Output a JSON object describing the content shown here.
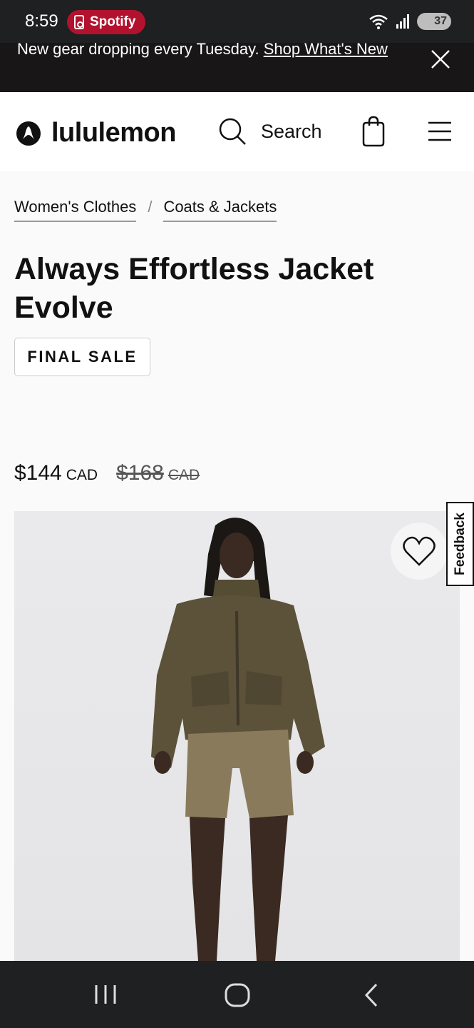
{
  "status_bar": {
    "time": "8:59",
    "app_pill": "Spotify",
    "battery": "37"
  },
  "promo": {
    "text": "New gear dropping every Tuesday.",
    "link": "Shop What's New"
  },
  "header": {
    "brand": "lululemon",
    "search_label": "Search"
  },
  "breadcrumbs": [
    {
      "label": "Women's Clothes"
    },
    {
      "label": "Coats & Jackets"
    }
  ],
  "breadcrumb_separator": "/",
  "product": {
    "title": "Always Effortless Jacket Evolve",
    "badge": "FINAL SALE",
    "price_now": "$144",
    "price_was": "$168",
    "currency": "CAD"
  },
  "feedback_label": "Feedback",
  "colors": {
    "promo_bg": "#181616",
    "pill": "#b3122e",
    "jacket": "#5b5239",
    "shorts": "#8a7a5c"
  }
}
